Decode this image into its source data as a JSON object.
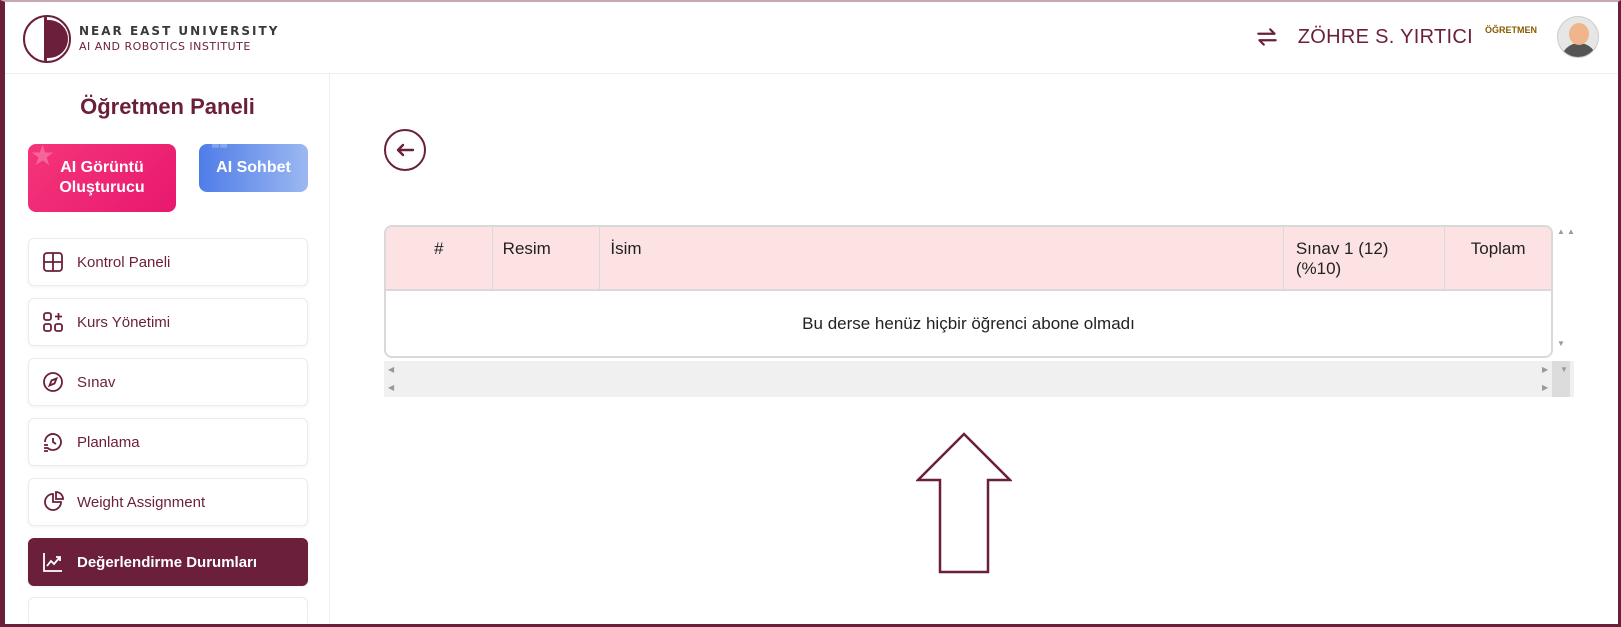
{
  "header": {
    "logo_line1": "NEAR EAST UNIVERSITY",
    "logo_line2": "AI AND ROBOTICS INSTITUTE",
    "user_name": "ZÖHRE S. YIRTICI",
    "user_role": "ÖĞRETMEN",
    "icons": [
      "switch-icon",
      "avatar"
    ]
  },
  "sidebar": {
    "title": "Öğretmen Paneli",
    "ai_image_label": "AI Görüntü Oluşturucu",
    "ai_chat_label": "AI Sohbet",
    "items": [
      {
        "label": "Kontrol Paneli",
        "icon": "grid-icon"
      },
      {
        "label": "Kurs Yönetimi",
        "icon": "apps-add-icon"
      },
      {
        "label": "Sınav",
        "icon": "compass-icon"
      },
      {
        "label": "Planlama",
        "icon": "history-icon"
      },
      {
        "label": "Weight Assignment",
        "icon": "pie-chart-icon"
      },
      {
        "label": "Değerlendirme Durumları",
        "icon": "trend-chart-icon",
        "active": true
      }
    ]
  },
  "table": {
    "columns": [
      "#",
      "Resim",
      "İsim",
      "Sınav 1 (12) (%10)",
      "Toplam"
    ],
    "empty_message": "Bu derse henüz hiçbir öğrenci abone olmadı"
  },
  "colors": {
    "brand": "#6b1f3a",
    "header_row": "#fde2e4",
    "ai_image_gradient": "#e8186f",
    "ai_chat_gradient": "#4f7de8"
  }
}
